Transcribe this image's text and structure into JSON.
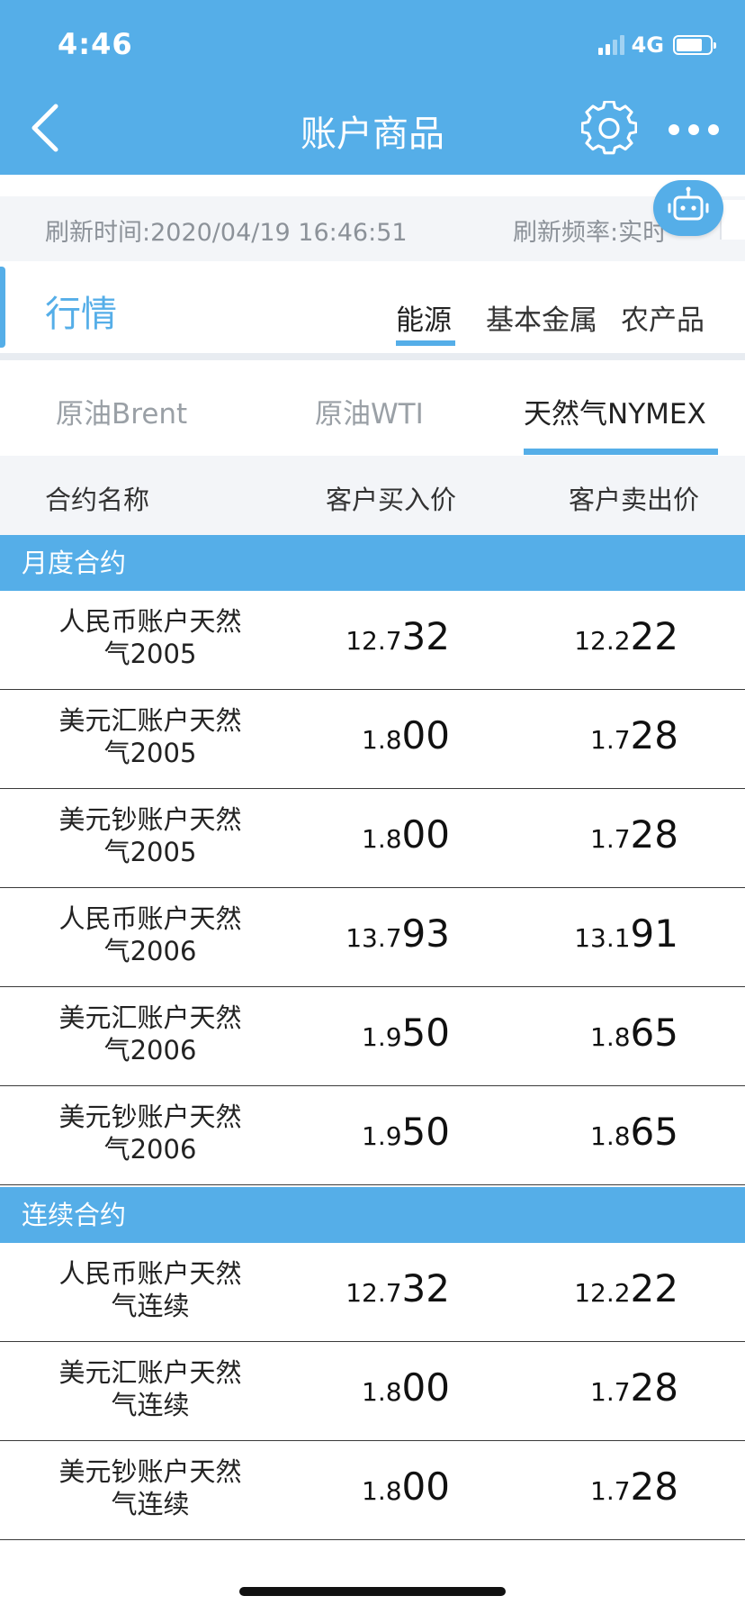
{
  "status_bar": {
    "time": "4:46",
    "network": "4G"
  },
  "header": {
    "title": "账户商品"
  },
  "refresh": {
    "time_label": "刷新时间:2020/04/19 16:46:51",
    "freq_label": "刷新频率:实时"
  },
  "market": {
    "title": "行情",
    "categories": [
      {
        "label": "能源",
        "active": true
      },
      {
        "label": "基本金属",
        "active": false
      },
      {
        "label": "农产品",
        "active": false
      }
    ]
  },
  "products": {
    "tabs": [
      {
        "label": "原油Brent",
        "active": false
      },
      {
        "label": "原油WTI",
        "active": false
      },
      {
        "label": "天然气NYMEX",
        "active": true
      }
    ]
  },
  "columns": {
    "name": "合约名称",
    "buy": "客户买入价",
    "sell": "客户卖出价"
  },
  "sections": [
    {
      "title": "月度合约",
      "rows": [
        {
          "name_l1": "人民币账户天然",
          "name_l2": "气2005",
          "buy_a": "12.7",
          "buy_b": "32",
          "sell_a": "12.2",
          "sell_b": "22"
        },
        {
          "name_l1": "美元汇账户天然",
          "name_l2": "气2005",
          "buy_a": "1.8",
          "buy_b": "00",
          "sell_a": "1.7",
          "sell_b": "28"
        },
        {
          "name_l1": "美元钞账户天然",
          "name_l2": "气2005",
          "buy_a": "1.8",
          "buy_b": "00",
          "sell_a": "1.7",
          "sell_b": "28"
        },
        {
          "name_l1": "人民币账户天然",
          "name_l2": "气2006",
          "buy_a": "13.7",
          "buy_b": "93",
          "sell_a": "13.1",
          "sell_b": "91"
        },
        {
          "name_l1": "美元汇账户天然",
          "name_l2": "气2006",
          "buy_a": "1.9",
          "buy_b": "50",
          "sell_a": "1.8",
          "sell_b": "65"
        },
        {
          "name_l1": "美元钞账户天然",
          "name_l2": "气2006",
          "buy_a": "1.9",
          "buy_b": "50",
          "sell_a": "1.8",
          "sell_b": "65"
        }
      ]
    },
    {
      "title": "连续合约",
      "rows": [
        {
          "name_l1": "人民币账户天然",
          "name_l2": "气连续",
          "buy_a": "12.7",
          "buy_b": "32",
          "sell_a": "12.2",
          "sell_b": "22"
        },
        {
          "name_l1": "美元汇账户天然",
          "name_l2": "气连续",
          "buy_a": "1.8",
          "buy_b": "00",
          "sell_a": "1.7",
          "sell_b": "28"
        },
        {
          "name_l1": "美元钞账户天然",
          "name_l2": "气连续",
          "buy_a": "1.8",
          "buy_b": "00",
          "sell_a": "1.7",
          "sell_b": "28"
        }
      ]
    }
  ],
  "colors": {
    "primary": "#55aee8",
    "band": "#f3f5f8"
  },
  "icons": [
    "back-arrow-icon",
    "gear-icon",
    "more-dots-icon",
    "robot-icon",
    "signal-icon",
    "battery-icon"
  ]
}
